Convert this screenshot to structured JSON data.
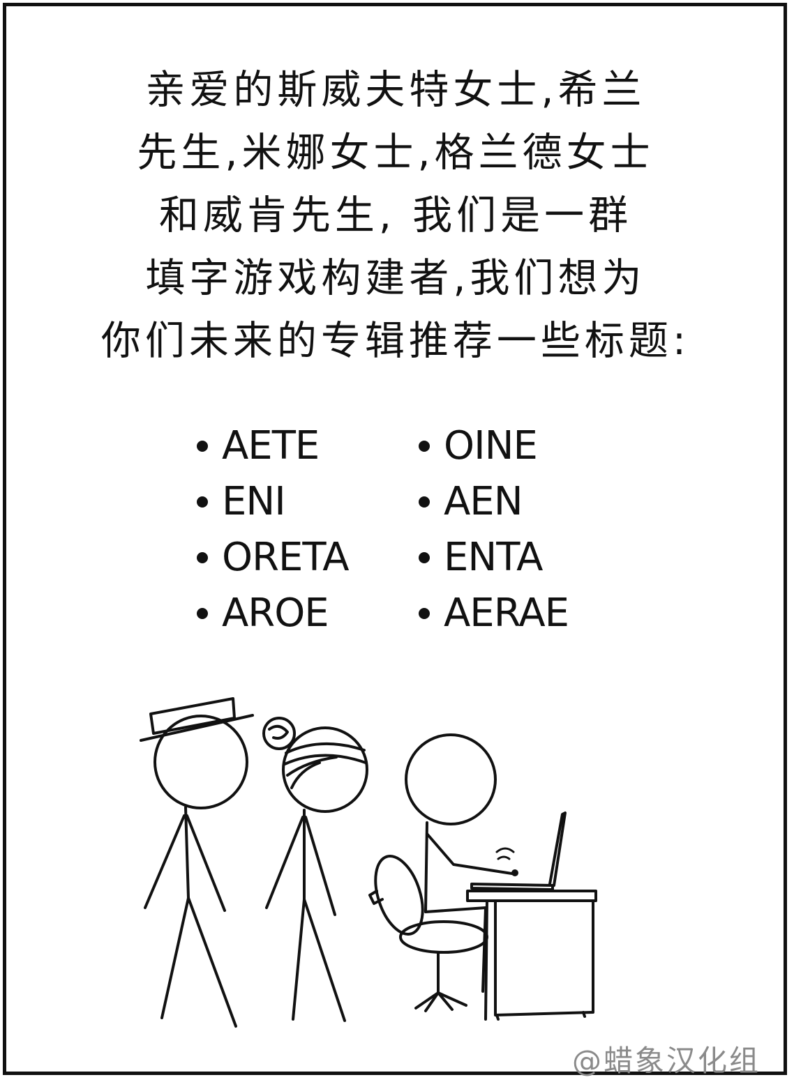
{
  "letter": {
    "lines": [
      "亲爱的斯威夫特女士,希兰",
      "先生,米娜女士,格兰德女士",
      "和威肯先生, 我们是一群",
      "填字游戏构建者,我们想为",
      "你们未来的专辑推荐一些标题:"
    ]
  },
  "titles": {
    "left": [
      "AETE",
      "ENI",
      "ORETA",
      "AROE"
    ],
    "right": [
      "OINE",
      "AEN",
      "ENTA",
      "AERAE"
    ]
  },
  "credit": "@蜡象汉化组"
}
